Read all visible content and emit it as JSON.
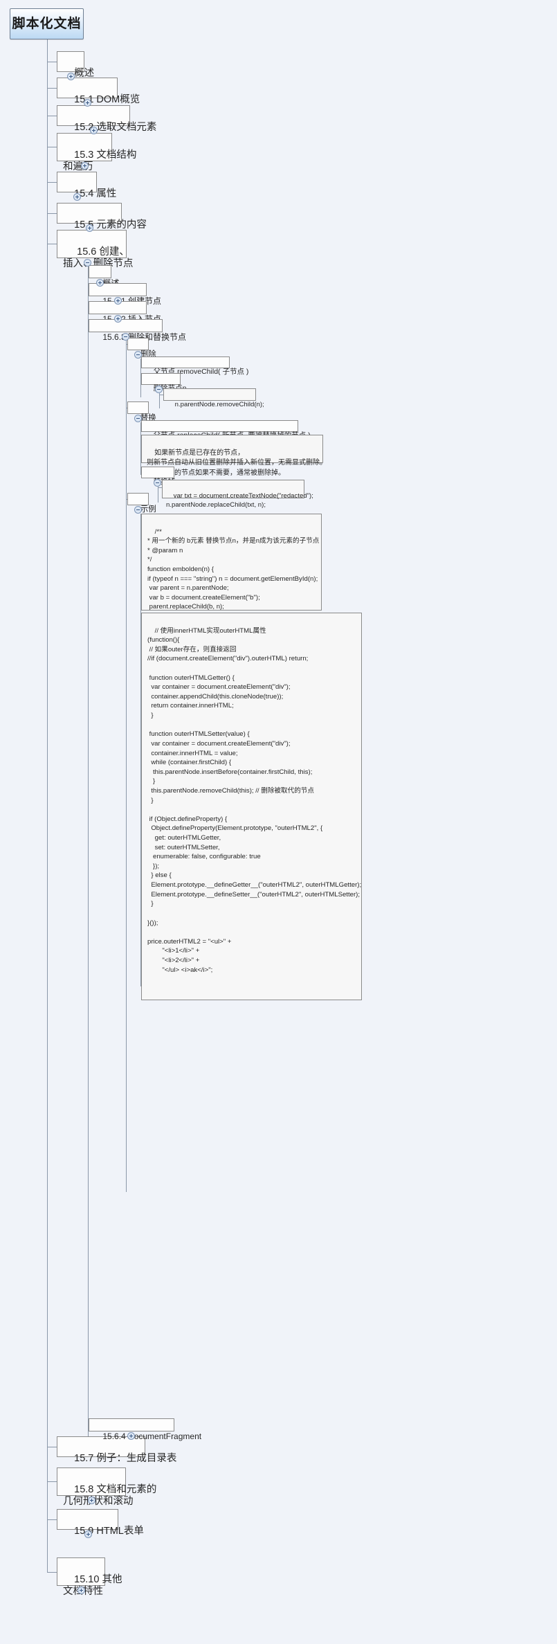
{
  "app": {
    "type": "mind-map",
    "background_color": "#f0f3f9",
    "node_border_color": "#8a8a8a",
    "connector_color": "#8a97a8",
    "toggle_color": "#dbe6f4",
    "root_gradient_from": "#ffffff",
    "root_gradient_to": "#bcd9f3"
  },
  "root": {
    "label": "脚本化文档",
    "toggle": "minus"
  },
  "level1": [
    {
      "label": "概述",
      "toggle": "plus"
    },
    {
      "label": "15.1 DOM概览",
      "toggle": "plus"
    },
    {
      "label": "15.2 选取文档元素",
      "toggle": "plus"
    },
    {
      "label": "15.3 文档结构\n和遍历",
      "toggle": "plus"
    },
    {
      "label": "15.4 属性",
      "toggle": "plus"
    },
    {
      "label": "15.5 元素的内容",
      "toggle": "plus"
    },
    {
      "label": " 15.6 创建、\n插入、删除节点",
      "toggle": "minus"
    },
    {
      "label": "15.7 例子：生成目录表",
      "toggle": "none"
    },
    {
      "label": "15.8 文档和元素的\n几何形状和滚动",
      "toggle": "plus"
    },
    {
      "label": "15.9 HTML表单",
      "toggle": "plus"
    },
    {
      "label": "15.10 其他\n文档特性",
      "toggle": "plus"
    }
  ],
  "level2": [
    {
      "label": "概述",
      "toggle": "plus"
    },
    {
      "label": "15.6.1 创建节点",
      "toggle": "plus"
    },
    {
      "label": "15.6.2 插入节点",
      "toggle": "plus"
    },
    {
      "label": "15.6.3 删除和替换节点",
      "toggle": "minus"
    },
    {
      "label": "15.6.4 DocumentFragment",
      "toggle": "plus"
    }
  ],
  "level3": [
    {
      "label": "删除",
      "toggle": "minus"
    },
    {
      "label": "替换",
      "toggle": "minus"
    },
    {
      "label": "示例",
      "toggle": "minus"
    }
  ],
  "delete_branch": [
    {
      "label": "父节点.removeChild( 子节点 )",
      "toggle": "none"
    },
    {
      "label": "删除节点n",
      "toggle": "minus"
    }
  ],
  "delete_code": {
    "label": "n.parentNode.removeChild(n);"
  },
  "replace_branch": [
    {
      "label": "父节点.replaceChild( 新节点, 要被替换掉的节点 )",
      "toggle": "none"
    },
    {
      "label": "替换掉n",
      "toggle": "minus"
    }
  ],
  "replace_note": {
    "label": "如果新节点是已存在的节点，\n则新节点自动从旧位置删除并插入新位置，无需显式删除。\n被替换掉的节点如果不需要，通常被删除掉。"
  },
  "replace_code": {
    "label": "var txt = document.createTextNode(\"redacted\");\nn.parentNode.replaceChild(txt, n);"
  },
  "example_code_1": {
    "label": "/**\n* 用一个新的 b元素 替换节点n，并是n成为该元素的子节点\n* @param n\n*/\nfunction embolden(n) {\nif (typeof n === \"string\") n = document.getElementById(n);\n var parent = n.parentNode;\n var b = document.createElement(\"b\");\n parent.replaceChild(b, n);\n b.appendChild(n);\n}"
  },
  "example_code_2": {
    "label": "// 使用innerHTML实现outerHTML属性\n(function(){\n // 如果outer存在，则直接返回\n//if (document.createElement(\"div\").outerHTML) return;\n\n function outerHTMLGetter() {\n  var container = document.createElement(\"div\");\n  container.appendChild(this.cloneNode(true));\n  return container.innerHTML;\n  }\n\n function outerHTMLSetter(value) {\n  var container = document.createElement(\"div\");\n  container.innerHTML = value;\n  while (container.firstChild) {\n   this.parentNode.insertBefore(container.firstChild, this);\n   }\n  this.parentNode.removeChild(this); // 删除被取代的节点\n  }\n\n if (Object.defineProperty) {\n  Object.defineProperty(Element.prototype, \"outerHTML2\", {\n    get: outerHTMLGetter,\n    set: outerHTMLSetter,\n   enumerable: false, configurable: true\n   });\n  } else {\n  Element.prototype.__defineGetter__(\"outerHTML2\", outerHTMLGetter);\n  Element.prototype.__defineSetter__(\"outerHTML2\", outerHTMLSetter);\n  }\n\n}());\n\nprice.outerHTML2 = \"<ul>\" +\n        \"<li>1</li>\" +\n        \"<li>2</li>\" +\n        \"</ul> <i>ak</i>\";"
  }
}
